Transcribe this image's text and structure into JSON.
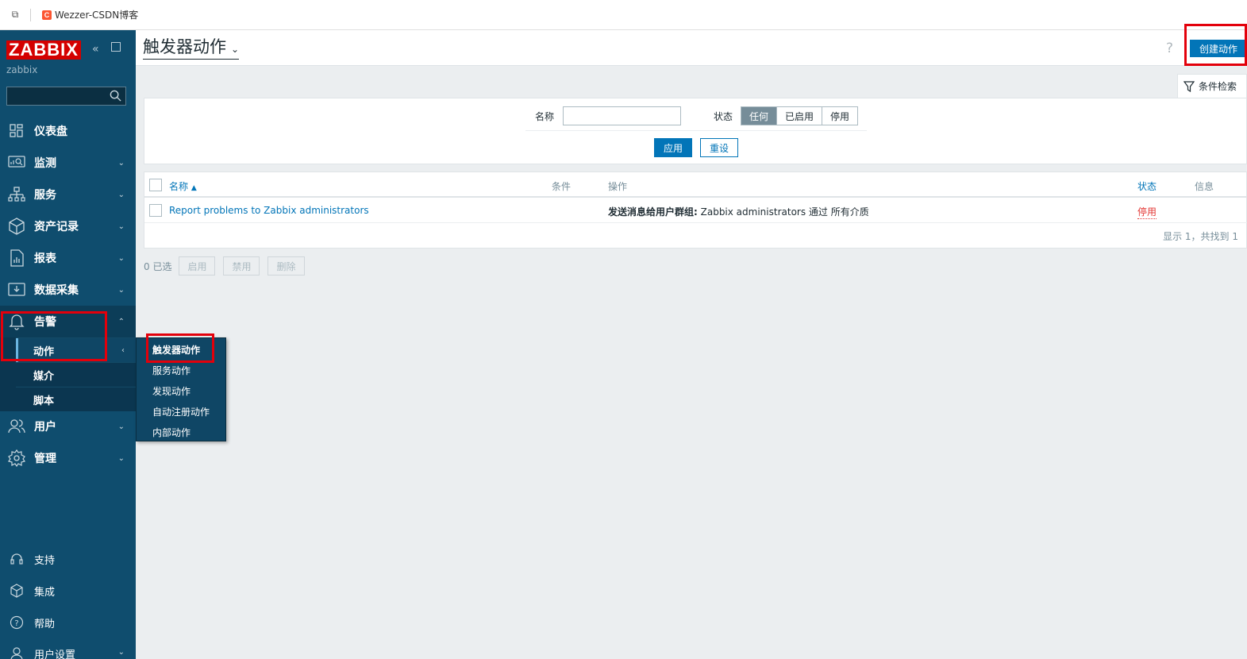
{
  "browser": {
    "copy_icon": "⧉",
    "favicon_letter": "C",
    "tab_title": "Wezzer-CSDN博客"
  },
  "sidebar": {
    "logo": "ZABBIX",
    "server_name": "zabbix",
    "search_placeholder": "",
    "items": [
      {
        "label": "仪表盘",
        "icon": "dashboard-icon"
      },
      {
        "label": "监测",
        "icon": "monitoring-icon"
      },
      {
        "label": "服务",
        "icon": "services-icon"
      },
      {
        "label": "资产记录",
        "icon": "inventory-icon"
      },
      {
        "label": "报表",
        "icon": "reports-icon"
      },
      {
        "label": "数据采集",
        "icon": "data-collection-icon"
      },
      {
        "label": "告警",
        "icon": "bell-icon"
      },
      {
        "label": "用户",
        "icon": "users-icon"
      },
      {
        "label": "管理",
        "icon": "gear-icon"
      }
    ],
    "alerts_sub": [
      {
        "label": "动作"
      },
      {
        "label": "媒介"
      },
      {
        "label": "脚本"
      }
    ],
    "bottom": [
      {
        "label": "支持",
        "icon": "headset-icon"
      },
      {
        "label": "集成",
        "icon": "cube-icon"
      },
      {
        "label": "帮助",
        "icon": "help-circle-icon"
      },
      {
        "label": "用户设置",
        "icon": "user-icon"
      }
    ]
  },
  "flyout": {
    "items": [
      "触发器动作",
      "服务动作",
      "发现动作",
      "自动注册动作",
      "内部动作"
    ]
  },
  "header": {
    "title": "触发器动作",
    "help": "?",
    "create_button": "创建动作"
  },
  "filter": {
    "tab_label": "条件检索",
    "name_label": "名称",
    "name_value": "",
    "status_label": "状态",
    "status_options": [
      "任何",
      "已启用",
      "停用"
    ],
    "status_selected": "任何",
    "apply": "应用",
    "reset": "重设"
  },
  "table": {
    "columns": [
      "名称",
      "条件",
      "操作",
      "状态",
      "信息"
    ],
    "sort_indicator": "▲",
    "rows": [
      {
        "name": "Report problems to Zabbix administrators",
        "conditions": "",
        "operation_bold": "发送消息给用户群组:",
        "operation_rest": " Zabbix administrators 通过 所有介质",
        "status": "停用",
        "info": ""
      }
    ],
    "footer": "显示 1，共找到 1"
  },
  "mass_actions": {
    "selected_count": "0 已选",
    "buttons": [
      "启用",
      "禁用",
      "删除"
    ]
  },
  "colors": {
    "sidebar_bg": "#0f4d6e",
    "accent": "#0275b8",
    "logo_red": "#d40000",
    "disabled_red": "#e33734",
    "highlight_box": "#e3000b"
  }
}
